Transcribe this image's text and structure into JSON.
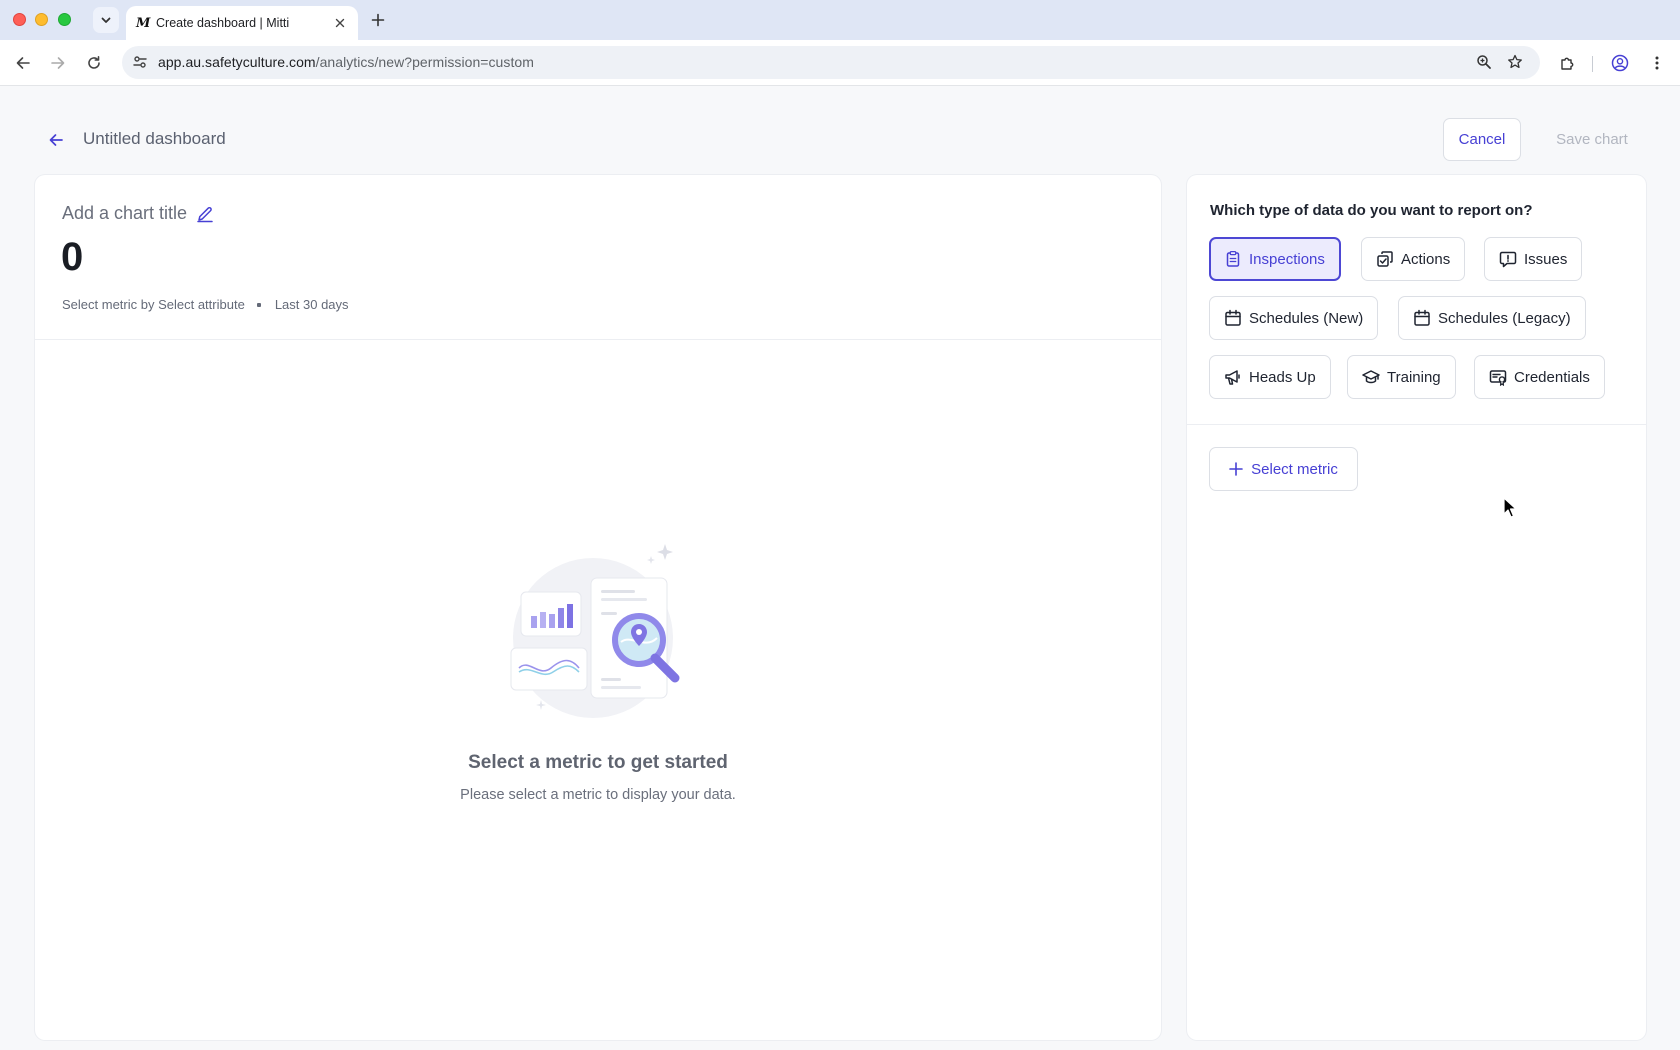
{
  "browser": {
    "tab_title": "Create dashboard | Mitti",
    "tab_favicon": "M",
    "url_host": "app.au.safetyculture.com",
    "url_path": "/analytics/new?permission=custom"
  },
  "header": {
    "title": "Untitled dashboard",
    "cancel_label": "Cancel",
    "save_label": "Save chart"
  },
  "chart": {
    "title_placeholder": "Add a chart title",
    "value": "0",
    "metric_text": "Select metric by Select attribute",
    "range_text": "Last 30 days",
    "empty_title": "Select a metric to get started",
    "empty_subtitle": "Please select a metric to display your data."
  },
  "data_panel": {
    "question": "Which type of data do you want to report on?",
    "types": [
      {
        "label": "Inspections",
        "icon": "clipboard-icon",
        "selected": true
      },
      {
        "label": "Actions",
        "icon": "actions-icon",
        "selected": false
      },
      {
        "label": "Issues",
        "icon": "issue-icon",
        "selected": false
      },
      {
        "label": "Schedules (New)",
        "icon": "calendar-icon",
        "selected": false
      },
      {
        "label": "Schedules (Legacy)",
        "icon": "calendar-icon",
        "selected": false
      },
      {
        "label": "Heads Up",
        "icon": "megaphone-icon",
        "selected": false
      },
      {
        "label": "Training",
        "icon": "graduation-cap-icon",
        "selected": false
      },
      {
        "label": "Credentials",
        "icon": "credential-icon",
        "selected": false
      }
    ],
    "select_metric_label": "Select metric"
  },
  "colors": {
    "accent": "#4740d4",
    "selected_bg": "#ecebfd",
    "page_bg": "#f7f8fa"
  }
}
